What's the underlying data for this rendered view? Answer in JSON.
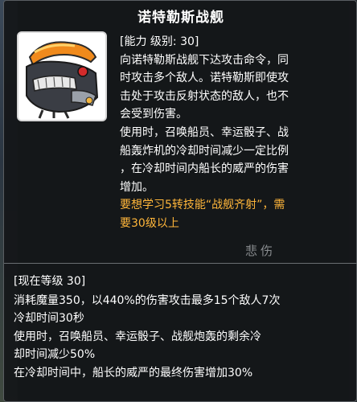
{
  "skill": {
    "title": "诺特勒斯战舰",
    "icon": "nautilus-battleship-icon",
    "description_lines": [
      "[能力 级别: 30]",
      "向诺特勒斯战舰下达攻击命令，同",
      "时攻击多个敌人。诺特勒斯即使攻",
      "击处于攻击反射状态的敌人，也不",
      "会受到伤害。",
      "使用时，召唤船员、幸运骰子、战",
      "船轰炸机的冷却时间减少一定比例",
      "，在冷却时间内船长的威严的伤害",
      "增加。"
    ],
    "requirement_lines": [
      "要想学习5转技能“战舰齐射”，需",
      "要30级以上"
    ],
    "watermark": "悲伤"
  },
  "current_level": {
    "header": "[现在等级 30]",
    "lines": [
      "消耗魔量350，以440%的伤害攻击最多15个敌人7次",
      "冷却时间30秒",
      "使用时，召唤船员、幸运骰子、战舰炮轰的剩余冷",
      "却时间减少50%",
      "在冷却时间中，船长的威严的最终伤害增加30%"
    ]
  },
  "colors": {
    "background": "#1f2122",
    "text": "#ffffff",
    "requirement": "#ffb63a"
  }
}
